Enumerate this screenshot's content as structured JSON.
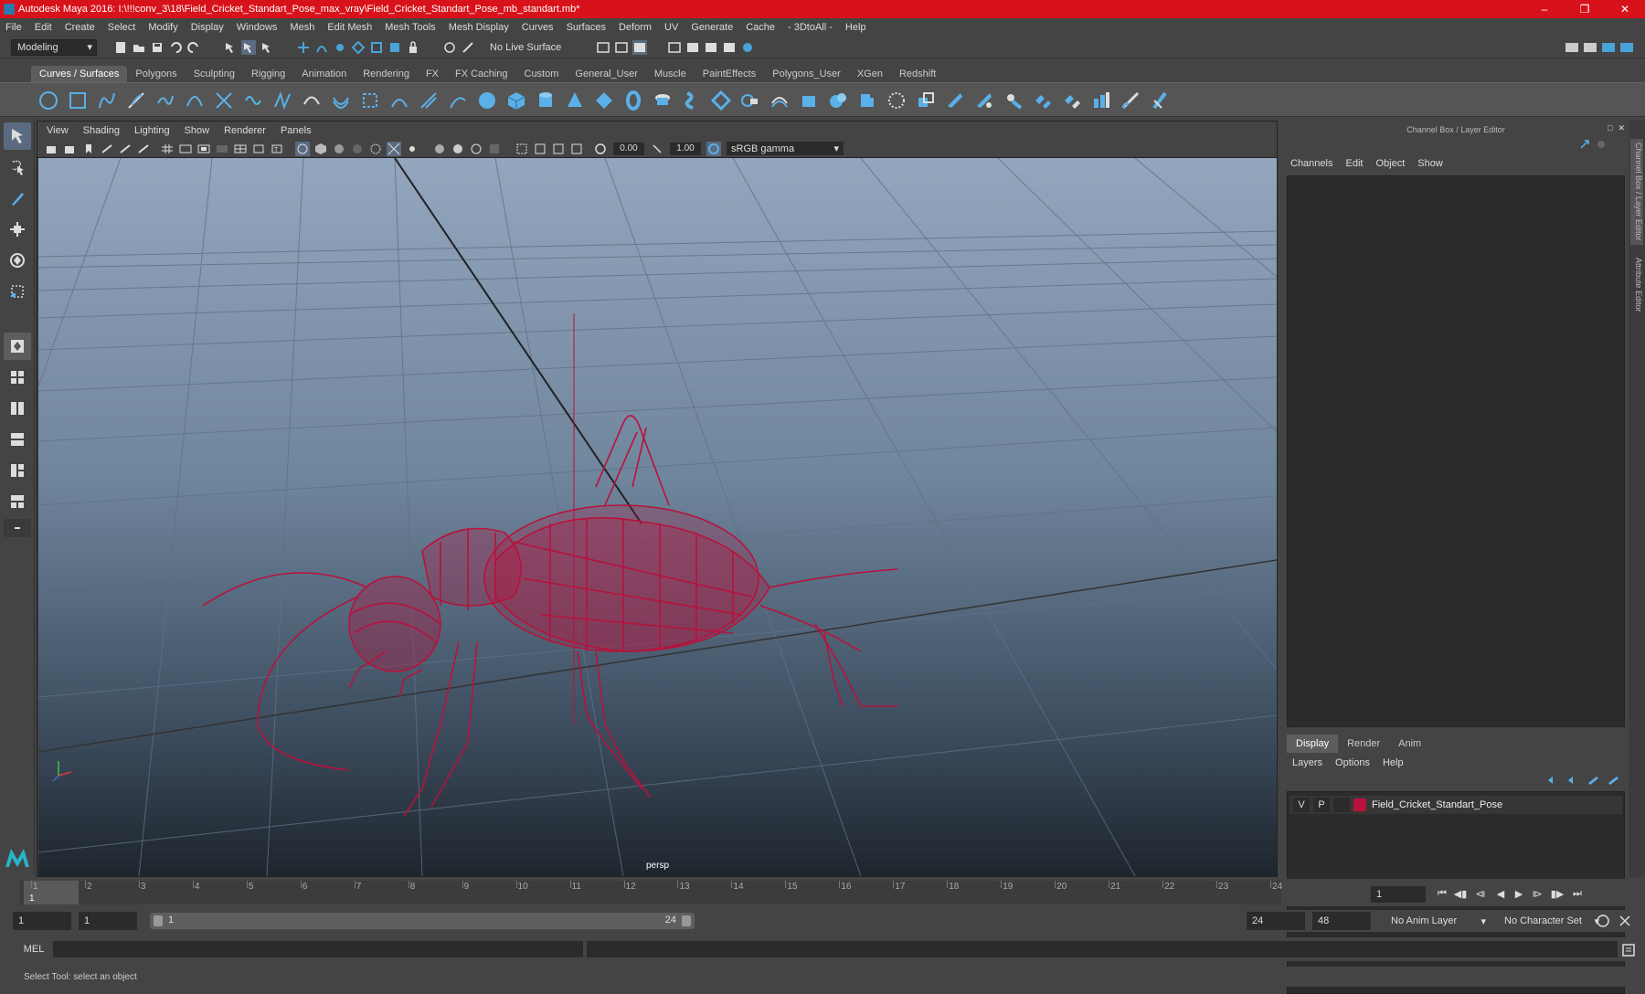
{
  "window": {
    "title": "Autodesk Maya 2016: I:\\!!!conv_3\\18\\Field_Cricket_Standart_Pose_max_vray\\Field_Cricket_Standart_Pose_mb_standart.mb*",
    "controls": [
      "–",
      "❐",
      "✕"
    ]
  },
  "menubar": [
    "File",
    "Edit",
    "Create",
    "Select",
    "Modify",
    "Display",
    "Windows",
    "Mesh",
    "Edit Mesh",
    "Mesh Tools",
    "Mesh Display",
    "Curves",
    "Surfaces",
    "Deform",
    "UV",
    "Generate",
    "Cache",
    "- 3DtoAll -",
    "Help"
  ],
  "statusline": {
    "mode": "Modeling",
    "live_surface": "No Live Surface"
  },
  "shelf_tabs": [
    "Curves / Surfaces",
    "Polygons",
    "Sculpting",
    "Rigging",
    "Animation",
    "Rendering",
    "FX",
    "FX Caching",
    "Custom",
    "General_User",
    "Muscle",
    "PaintEffects",
    "Polygons_User",
    "XGen",
    "Redshift"
  ],
  "shelf_active": "Curves / Surfaces",
  "viewport": {
    "menu": [
      "View",
      "Shading",
      "Lighting",
      "Show",
      "Renderer",
      "Panels"
    ],
    "exposure": "0.00",
    "gamma_value": "1.00",
    "color_space": "sRGB gamma",
    "camera": "persp"
  },
  "channel_box": {
    "title": "Channel Box / Layer Editor",
    "menu": [
      "Channels",
      "Edit",
      "Object",
      "Show"
    ]
  },
  "layer_editor": {
    "tabs": [
      "Display",
      "Render",
      "Anim"
    ],
    "active_tab": "Display",
    "menu": [
      "Layers",
      "Options",
      "Help"
    ],
    "layers": [
      {
        "v": "V",
        "p": "P",
        "name": "Field_Cricket_Standart_Pose",
        "color": "#b8123c"
      }
    ]
  },
  "side_tabs": [
    "Channel Box / Layer Editor",
    "Attribute Editor"
  ],
  "timeline": {
    "ticks": [
      "1",
      "2",
      "3",
      "4",
      "5",
      "6",
      "7",
      "8",
      "9",
      "10",
      "11",
      "12",
      "13",
      "14",
      "15",
      "16",
      "17",
      "18",
      "19",
      "20",
      "21",
      "22",
      "23",
      "24"
    ],
    "current_frame_marker": "1",
    "current_frame": "1"
  },
  "range": {
    "start": "1",
    "playback_start": "1",
    "slider_start": "1",
    "slider_end": "24",
    "playback_end": "24",
    "end": "48",
    "anim_layer": "No Anim Layer",
    "character_set": "No Character Set"
  },
  "command": {
    "language": "MEL"
  },
  "help_line": "Select Tool: select an object",
  "colors": {
    "title_bar": "#d8121a",
    "wireframe": "#b8123c",
    "accent": "#4aa3d8"
  }
}
